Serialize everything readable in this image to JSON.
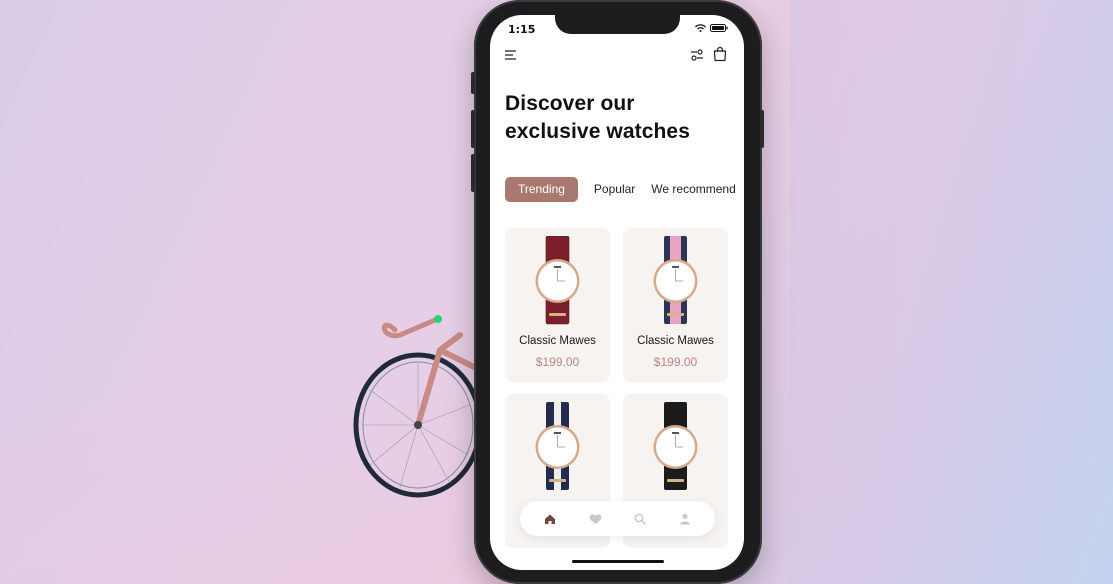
{
  "status_bar": {
    "time": "1:15"
  },
  "header": {
    "title": "Discover our exclusive watches"
  },
  "tabs": [
    {
      "label": "Trending",
      "active": true
    },
    {
      "label": "Popular",
      "active": false
    },
    {
      "label": "We recommend",
      "active": false
    }
  ],
  "products": [
    {
      "name": "Classic Mawes",
      "price": "$199.00",
      "strap": "burgundy"
    },
    {
      "name": "Classic Mawes",
      "price": "$199.00",
      "strap": "pink-navy-stripe"
    },
    {
      "name": "",
      "price": "",
      "strap": "navy-white-stripe"
    },
    {
      "name": "",
      "price": "",
      "strap": "black"
    }
  ],
  "bottom_nav": [
    {
      "icon": "home-icon",
      "active": true
    },
    {
      "icon": "heart-icon",
      "active": false
    },
    {
      "icon": "search-icon",
      "active": false
    },
    {
      "icon": "user-icon",
      "active": false
    }
  ],
  "colors": {
    "accent": "#a9786f",
    "price": "#b9877e",
    "card_bg": "#f6f3f0",
    "nav_active": "#6b4a43",
    "nav_inactive": "#c9c9c9"
  }
}
